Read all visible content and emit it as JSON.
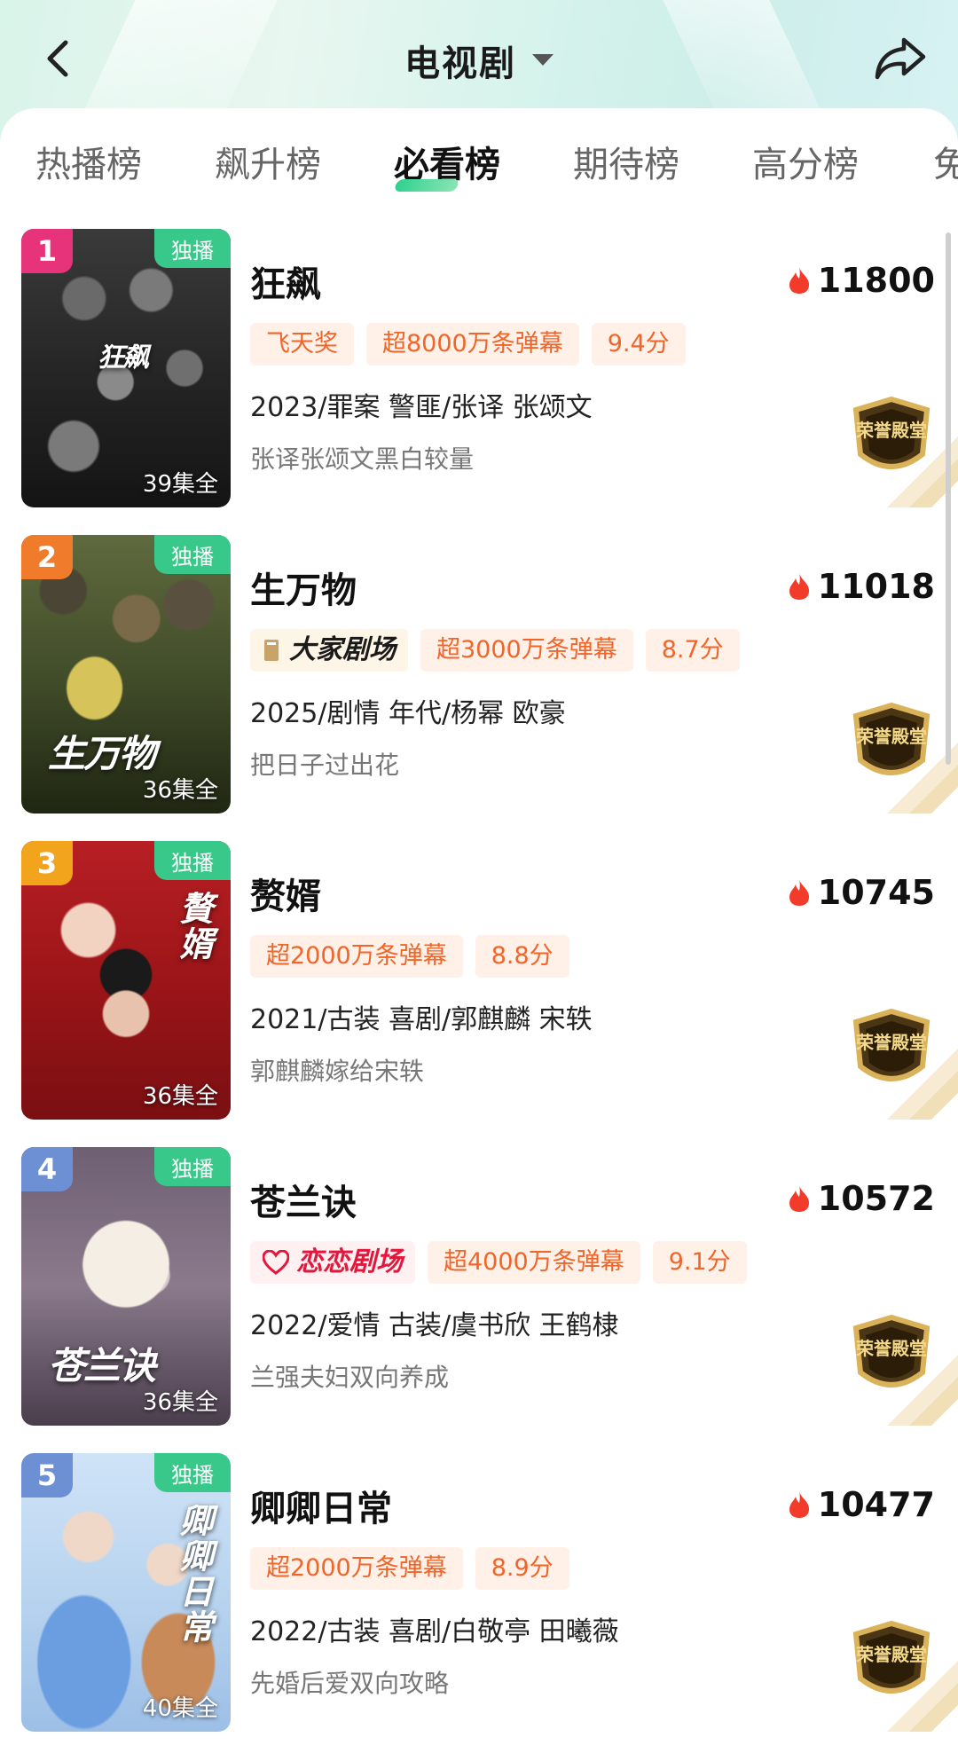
{
  "header": {
    "title": "电视剧",
    "back_icon": "chevron-left-icon",
    "dropdown_icon": "caret-down-icon",
    "share_icon": "share-arrow-icon"
  },
  "tabs": [
    {
      "label": "热播榜",
      "active": false
    },
    {
      "label": "飙升榜",
      "active": false
    },
    {
      "label": "必看榜",
      "active": true
    },
    {
      "label": "期待榜",
      "active": false
    },
    {
      "label": "高分榜",
      "active": false
    },
    {
      "label": "免",
      "active": false
    }
  ],
  "colors": {
    "accent_green": "#38c889",
    "tag_orange": "#f0652a",
    "rank1": "#e6337a",
    "rank2": "#f07b2a",
    "rank3": "#f2a51c",
    "rank4": "#6d8fd3",
    "rank5": "#6d8fd3"
  },
  "items": [
    {
      "rank": "1",
      "exclusive": "独播",
      "episodes": "39集全",
      "name": "狂飙",
      "heat": "11800",
      "tags": [
        "飞天奖",
        "超8000万条弹幕",
        "9.4分"
      ],
      "meta": "2023/罪案 警匪/张译 张颂文",
      "desc": "张译张颂文黑白较量",
      "poster_text": "狂飙"
    },
    {
      "rank": "2",
      "exclusive": "独播",
      "episodes": "36集全",
      "name": "生万物",
      "heat": "11018",
      "logo": "大家剧场",
      "tags": [
        "超3000万条弹幕",
        "8.7分"
      ],
      "meta": "2025/剧情 年代/杨幂 欧豪",
      "desc": "把日子过出花",
      "poster_text": "生万物"
    },
    {
      "rank": "3",
      "exclusive": "独播",
      "episodes": "36集全",
      "name": "赘婿",
      "heat": "10745",
      "tags": [
        "超2000万条弹幕",
        "8.8分"
      ],
      "meta": "2021/古装 喜剧/郭麒麟 宋轶",
      "desc": "郭麒麟嫁给宋轶",
      "poster_text": "贅婿"
    },
    {
      "rank": "4",
      "exclusive": "独播",
      "episodes": "36集全",
      "name": "苍兰诀",
      "heat": "10572",
      "logo": "恋恋剧场",
      "tags": [
        "超4000万条弹幕",
        "9.1分"
      ],
      "meta": "2022/爱情 古装/虞书欣 王鹤棣",
      "desc": "兰强夫妇双向养成",
      "poster_text": "苍兰诀"
    },
    {
      "rank": "5",
      "exclusive": "独播",
      "episodes": "40集全",
      "name": "卿卿日常",
      "heat": "10477",
      "tags": [
        "超2000万条弹幕",
        "8.9分"
      ],
      "meta": "2022/古装 喜剧/白敬亭 田曦薇",
      "desc": "先婚后爱双向攻略",
      "poster_text": "卿卿日常"
    }
  ],
  "honor_badge_text": "荣誉殿堂"
}
